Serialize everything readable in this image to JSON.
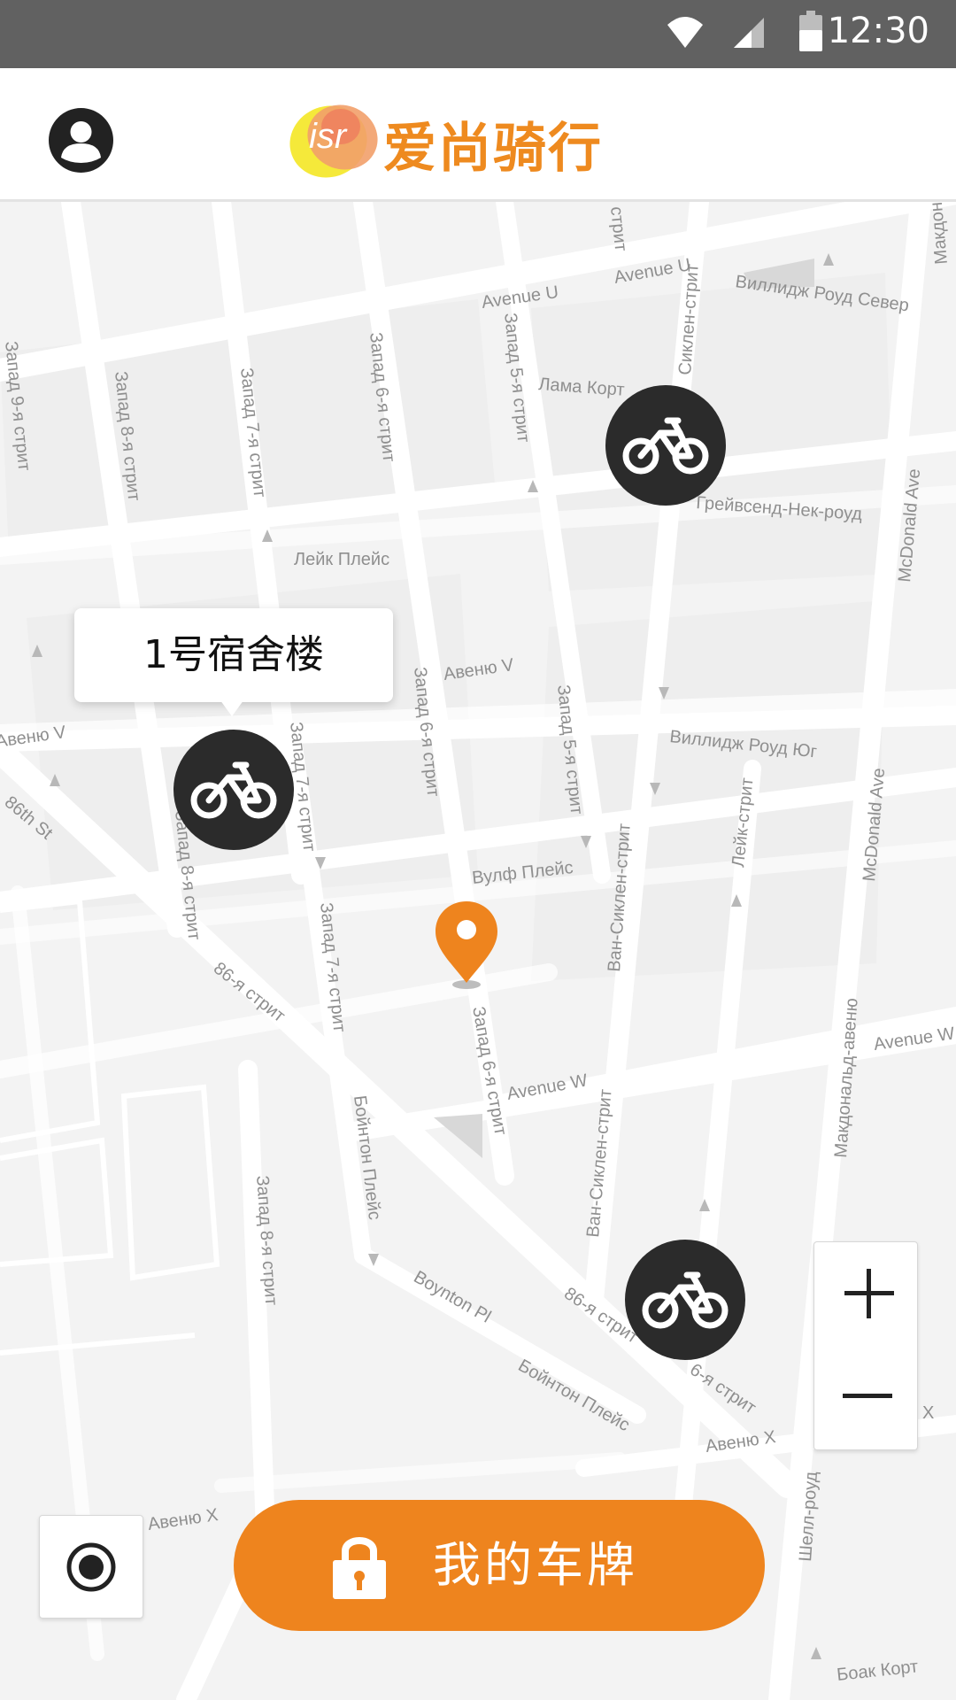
{
  "status_bar": {
    "time": "12:30",
    "icons": [
      "wifi-icon",
      "cellular-signal-icon",
      "battery-icon"
    ]
  },
  "header": {
    "logo_mark": "isr",
    "app_name": "爱尚骑行",
    "avatar_icon": "user-avatar-icon"
  },
  "map": {
    "streets": [
      "Avenue U",
      "Avenue U",
      "Виллидж Роуд Север",
      "Макдональд-авеню",
      "McDonald Ave",
      "Лама Корт",
      "Грейвсенд-Нек-роуд",
      "Лейк Плейс",
      "Авеню V",
      "Виллидж Роуд Юг",
      "McDonald Ave",
      "Вулф Плейс",
      "Лейк-стрит",
      "86th St",
      "86-я стрит",
      "Запад 6-я стрит",
      "Avenue W",
      "Avenue W",
      "Макдональд-авеню",
      "Ван-Сиклен-стрит",
      "Бойнтон Плейс",
      "Boynton Pl",
      "Бойнтон Плейс",
      "86-я стрит",
      "6-я стрит",
      "Авеню X",
      "Авеню X",
      "Шелл-роуд",
      "Боак Корт",
      "Запад 8-я стрит",
      "Запад 7-я стрит",
      "Запад 6-я стрит",
      "Запад 5-я стрит",
      "Запад 5-я стрит",
      "Запад 6-я стрит",
      "Запад 8-я стрит",
      "Запад 7-я стрит",
      "Запад 7-я стрит",
      "Запад 8-я стрит",
      "Ван-Сиклен-стрит",
      "Запад 9-я стрит",
      "Авеню V",
      "стрит",
      "Сиклен-стрит",
      "X"
    ],
    "station_callout": "1号宿舍楼",
    "bike_icon": "bicycle-icon",
    "location_pin_icon": "location-pin-icon"
  },
  "controls": {
    "zoom_in": "+",
    "zoom_out": "−",
    "locate_icon": "my-location-icon"
  },
  "bottom_button": {
    "label": "我的车牌",
    "icon": "lock-icon"
  },
  "colors": {
    "accent": "#ee841e",
    "marker": "#2b2b2b",
    "status_bar": "#616161"
  }
}
